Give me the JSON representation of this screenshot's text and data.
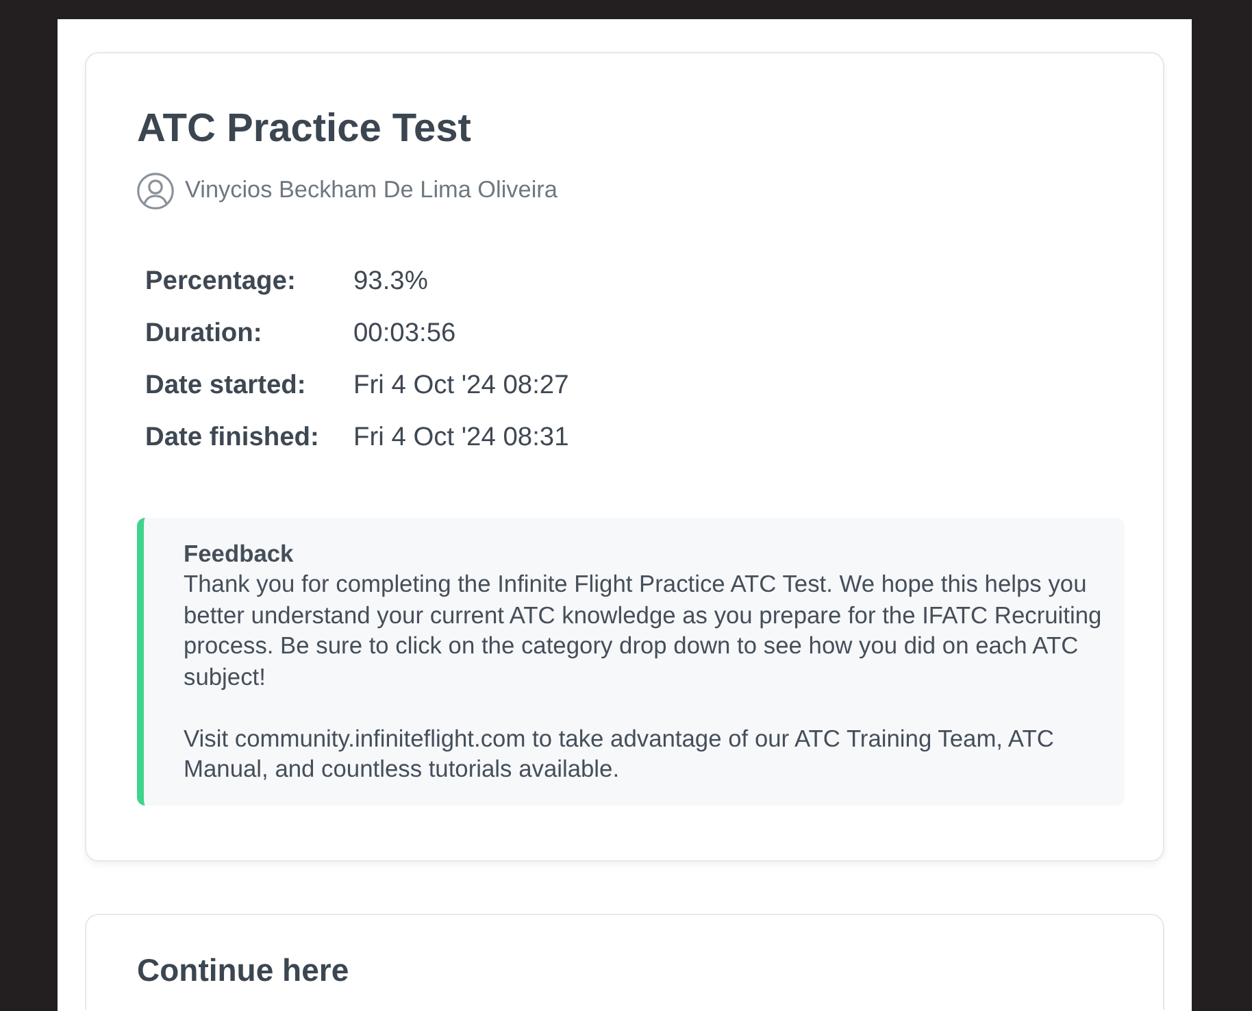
{
  "result": {
    "title": "ATC Practice Test",
    "user_name": "Vinycios Beckham De Lima Oliveira",
    "details": [
      {
        "label": "Percentage:",
        "value": "93.3%"
      },
      {
        "label": "Duration:",
        "value": "00:03:56"
      },
      {
        "label": "Date started:",
        "value": "Fri 4 Oct '24 08:27"
      },
      {
        "label": "Date finished:",
        "value": "Fri 4 Oct '24 08:31"
      }
    ],
    "feedback": {
      "title": "Feedback",
      "paragraphs": [
        "Thank you for completing the Infinite Flight Practice ATC Test. We hope this helps you better understand your current ATC knowledge as you prepare for the IFATC Recruiting process. Be sure to click on the category drop down to see how you did on each ATC subject!",
        "Visit community.infiniteflight.com to take advantage of our ATC Training Team, ATC Manual, and countless tutorials available."
      ]
    }
  },
  "next": {
    "title": "Continue here"
  }
}
